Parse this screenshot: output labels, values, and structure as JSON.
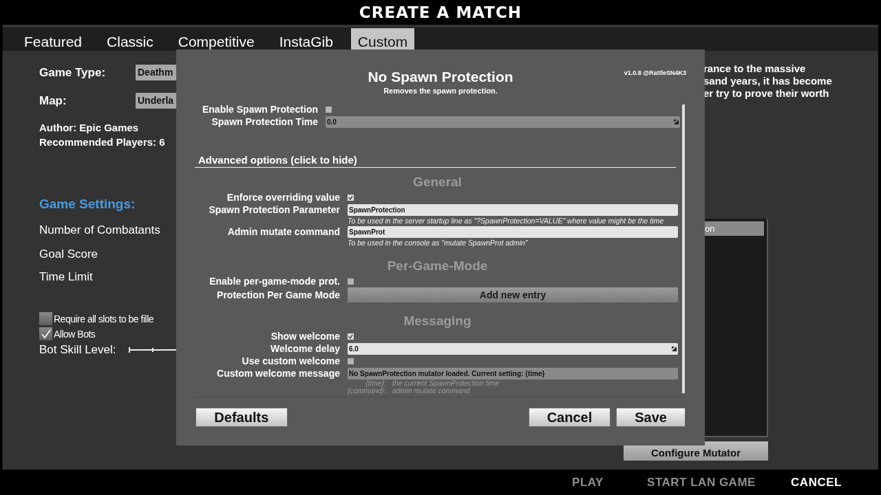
{
  "window": {
    "title": "CREATE A MATCH"
  },
  "tabs": [
    {
      "label": "Featured",
      "selected": false
    },
    {
      "label": "Classic",
      "selected": false
    },
    {
      "label": "Competitive",
      "selected": false
    },
    {
      "label": "InstaGib",
      "selected": false
    },
    {
      "label": "Custom",
      "selected": true
    }
  ],
  "game_info": {
    "fields": [
      {
        "label": "Game Type:",
        "value": "Deathm"
      },
      {
        "label": "Map:",
        "value": "Underla"
      }
    ],
    "author": "Author: Epic Games",
    "recommended_players": "Recommended Players: 6"
  },
  "game_settings": {
    "heading": "Game Settings:",
    "settings": [
      "Number of Combatants",
      "Goal Score",
      "Time Limit"
    ],
    "options": [
      {
        "label": "Require all slots to be fille",
        "checked": false
      },
      {
        "label": "Allow Bots",
        "checked": true
      }
    ],
    "bot_skill_label": "Bot Skill Level:"
  },
  "description": [
    "rance to the massive",
    "sand years, it has become",
    "er try to prove their worth"
  ],
  "mutator_list": {
    "items": [
      {
        "label": "on",
        "selected": true
      }
    ]
  },
  "configure_button": "Configure Mutator",
  "footer_actions": [
    {
      "label": "PLAY",
      "disabled": true
    },
    {
      "label": "START LAN GAME",
      "disabled": true
    },
    {
      "label": "CANCEL",
      "disabled": false
    }
  ],
  "dialog": {
    "title": "No Spawn Protection",
    "subtitle": "Removes the spawn protection.",
    "version": "v1.0.8 @RattleSN4K3",
    "basic_rows": [
      {
        "kind": "checkbox",
        "label": "Enable Spawn Protection",
        "checked": false
      },
      {
        "kind": "number",
        "label": "Spawn Protection Time",
        "value": "0.0",
        "disabled": true
      }
    ],
    "advanced_toggle": "Advanced options (click to hide)",
    "sections": [
      {
        "heading": "General",
        "rows": [
          {
            "kind": "checkbox",
            "label": "Enforce overriding value",
            "checked": true
          },
          {
            "kind": "text",
            "label": "Spawn Protection Parameter",
            "value": "SpawnProtection",
            "disabled": false,
            "hint": "To be used in the server startup line as \"?SpawnProtection=VALUE\" where value might be the time"
          },
          {
            "kind": "text",
            "label": "Admin mutate command",
            "value": "SpawnProt",
            "disabled": false,
            "hint": "To be used in the console as \"mutate SpawnProt admin\""
          }
        ]
      },
      {
        "heading": "Per-Game-Mode",
        "rows": [
          {
            "kind": "checkbox",
            "label": "Enable per-game-mode prot.",
            "checked": false
          },
          {
            "kind": "button",
            "label": "Protection Per Game Mode",
            "value": "Add new entry"
          }
        ]
      },
      {
        "heading": "Messaging",
        "rows": [
          {
            "kind": "checkbox",
            "label": "Show welcome",
            "checked": true
          },
          {
            "kind": "number",
            "label": "Welcome delay",
            "value": "6.0",
            "disabled": false
          },
          {
            "kind": "checkbox",
            "label": "Use custom welcome",
            "checked": false
          },
          {
            "kind": "text",
            "label": "Custom welcome message",
            "value": "No SpawnProtection mutator loaded. Current setting: {time}",
            "disabled": true,
            "legend": [
              {
                "key": "{time}:",
                "text": "the current SpawnProtection time"
              },
              {
                "key": "{command}:",
                "text": "admin mutate command"
              }
            ]
          }
        ]
      }
    ],
    "buttons": [
      "Defaults",
      "Cancel",
      "Save"
    ]
  }
}
